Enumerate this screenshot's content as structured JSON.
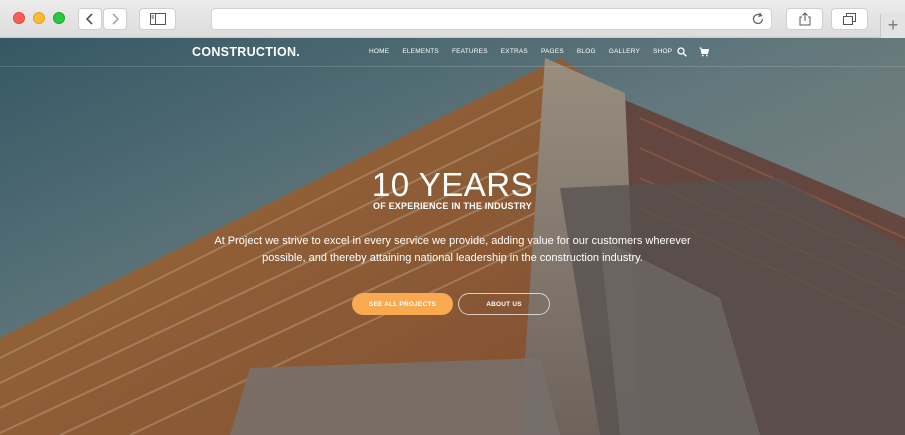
{
  "browser": {
    "tab_add_symbol": "+"
  },
  "site": {
    "logo": "CONSTRUCTION.",
    "menu": [
      "HOME",
      "ELEMENTS",
      "FEATURES",
      "EXTRAS",
      "PAGES",
      "BLOG",
      "GALLERY",
      "SHOP"
    ]
  },
  "hero": {
    "title": "10 YEARS",
    "subtitle": "OF EXPERIENCE  IN THE INDUSTRY",
    "description": "At Project we strive to excel in every service we provide, adding value for our customers wherever possible, and thereby attaining national leadership in the construction industry.",
    "primary_button": "SEE ALL PROJECTS",
    "secondary_button": "ABOUT US"
  },
  "colors": {
    "accent": "#f9a94f"
  }
}
